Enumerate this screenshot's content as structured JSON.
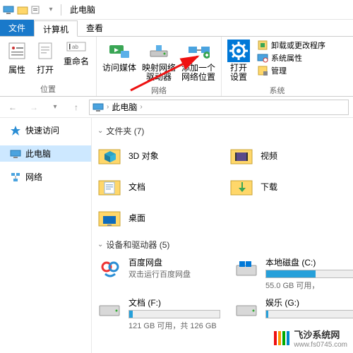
{
  "titlebar": {
    "title": "此电脑"
  },
  "tabs": {
    "file": "文件",
    "computer": "计算机",
    "view": "查看"
  },
  "ribbon": {
    "group1": {
      "label": "位置",
      "properties": "属性",
      "open": "打开",
      "rename": "重命名"
    },
    "group2": {
      "label": "网络",
      "media": "访问媒体",
      "mapdrive": "映射网络\n驱动器",
      "addloc": "添加一个\n网络位置"
    },
    "group3": {
      "label": "系统",
      "opensettings": "打开\n设置",
      "uninstall": "卸载或更改程序",
      "sysprops": "系统属性",
      "manage": "管理"
    }
  },
  "breadcrumb": {
    "this_pc": "此电脑"
  },
  "sidebar": {
    "quick": "快速访问",
    "this_pc": "此电脑",
    "network": "网络"
  },
  "sections": {
    "folders_hdr": "文件夹 (7)",
    "drives_hdr": "设备和驱动器 (5)"
  },
  "folders": {
    "objects3d": "3D 对象",
    "videos": "视频",
    "documents": "文档",
    "downloads": "下载",
    "desktop": "桌面"
  },
  "drives": {
    "baidu": {
      "name": "百度网盘",
      "sub": "双击运行百度网盘"
    },
    "c": {
      "name": "本地磁盘 (C:)",
      "sub": "55.0 GB 可用，",
      "pct": 55
    },
    "f": {
      "name": "文档 (F:)",
      "sub": "121 GB 可用，共 126 GB",
      "pct": 4
    },
    "g": {
      "name": "娱乐 (G:)",
      "sub": "",
      "pct": 2
    }
  },
  "watermark": {
    "text": "飞沙系统网",
    "url": "www.fs0745.com"
  }
}
